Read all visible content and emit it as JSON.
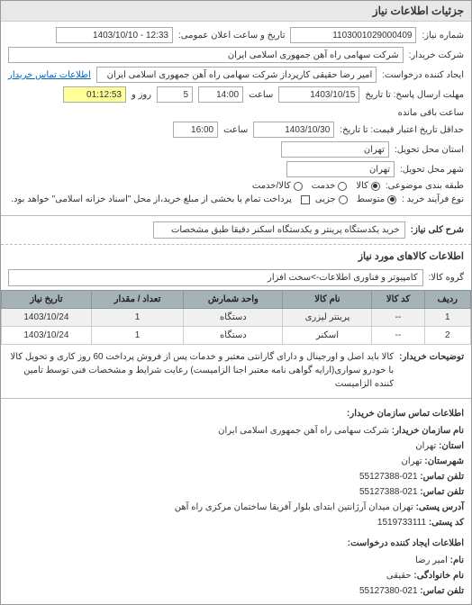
{
  "page_title": "جزئیات اطلاعات نیاز",
  "header": {
    "request_no_label": "شماره نیاز:",
    "request_no": "1103001029000409",
    "announce_label": "تاریخ و ساعت اعلان عمومی:",
    "announce_value": "12:33 - 1403/10/10",
    "buyer_label": "شرکت خریدار:",
    "buyer_value": "شرکت سهامی راه آهن جمهوری اسلامی ایران",
    "creator_label": "ایجاد کننده درخواست:",
    "creator_value": "امیر رضا  حقیقی کارپرداز شرکت سهامی راه آهن جمهوری اسلامی ایران",
    "contact_link": "اطلاعات تماس خریدار",
    "deadline_label": "مهلت ارسال پاسخ: تا تاریخ",
    "deadline_date": "1403/10/15",
    "time_label": "ساعت",
    "deadline_time": "14:00",
    "remain_days": "5",
    "remain_days_label": "روز و",
    "remain_time": "01:12:53",
    "remain_suffix": "ساعت باقی مانده",
    "validity_label": "حداقل تاریخ اعتبار قیمت: تا تاریخ:",
    "validity_date": "1403/10/30",
    "validity_time": "16:00",
    "province_label": "استان محل تحویل:",
    "province_value": "تهران",
    "city_label": "شهر محل تحویل:",
    "city_value": "تهران",
    "packing_label": "طبقه بندی موضوعی:",
    "packing_options": [
      "کالا",
      "خدمت",
      "کالا/خدمت"
    ],
    "packing_selected": 0,
    "process_label": "نوع فرآیند خرید :",
    "process_options": [
      "متوسط",
      "جزیی"
    ],
    "process_selected": 0,
    "process_note_label": "پرداخت تمام یا بخشی از مبلغ خرید،از محل \"اسناد خزانه اسلامی\" خواهد بود.",
    "process_note_checked": false
  },
  "desc": {
    "label": "شرح کلی نیاز:",
    "value": "خرید یکدستگاه پرینتر و یکدستگاه اسکنر دقیقا طبق مشخصات"
  },
  "items_heading": "اطلاعات کالاهای مورد نیاز",
  "group": {
    "label": "گروه کالا:",
    "value": "کامپیوتر و فناوری اطلاعات->سخت افزار"
  },
  "table": {
    "headers": [
      "ردیف",
      "کد کالا",
      "نام کالا",
      "واحد شمارش",
      "تعداد / مقدار",
      "تاریخ نیاز"
    ],
    "rows": [
      [
        "1",
        "--",
        "پرینتر لیزری",
        "دستگاه",
        "1",
        "1403/10/24"
      ],
      [
        "2",
        "--",
        "اسکنر",
        "دستگاه",
        "1",
        "1403/10/24"
      ]
    ]
  },
  "notes": {
    "label": "توضیحات خریدار:",
    "text": "کالا باید اصل و اورجینال و دارای گارانتی معتبر و خدمات پس از فروش پرداخت 60 روز کاری و تحویل کالا با خودرو سواری(ارایه گواهی نامه معتبر اجنا الزامیست) رعایت شرایط و مشخصات فنی توسط تامین کننده الزامیست"
  },
  "contact": {
    "heading": "اطلاعات تماس سازمان خریدار:",
    "org_label": "نام سازمان خریدار:",
    "org_value": "شرکت سهامی راه آهن جمهوری اسلامی ایران",
    "province_label": "استان:",
    "province_value": "تهران",
    "city_label": "شهرستان:",
    "city_value": "تهران",
    "phone_label": "تلفن تماس:",
    "phone_value": "021-55127388",
    "fax_label": "تلفن تماس:",
    "fax_value": "021-55127388",
    "address_label": "آدرس پستی:",
    "address_value": "تهران میدان آرژانتین ابتدای بلوار آفریقا ساختمان مرکزی راه آهن",
    "postal_label": "کد پستی:",
    "postal_value": "1519733111",
    "creator_heading": "اطلاعات ایجاد کننده درخواست:",
    "creator_name_label": "نام:",
    "creator_name_value": "امیر رضا",
    "creator_family_label": "نام خانوادگی:",
    "creator_family_value": "حقیقی",
    "creator_phone_label": "تلفن تماس:",
    "creator_phone_value": "021-55127380"
  }
}
